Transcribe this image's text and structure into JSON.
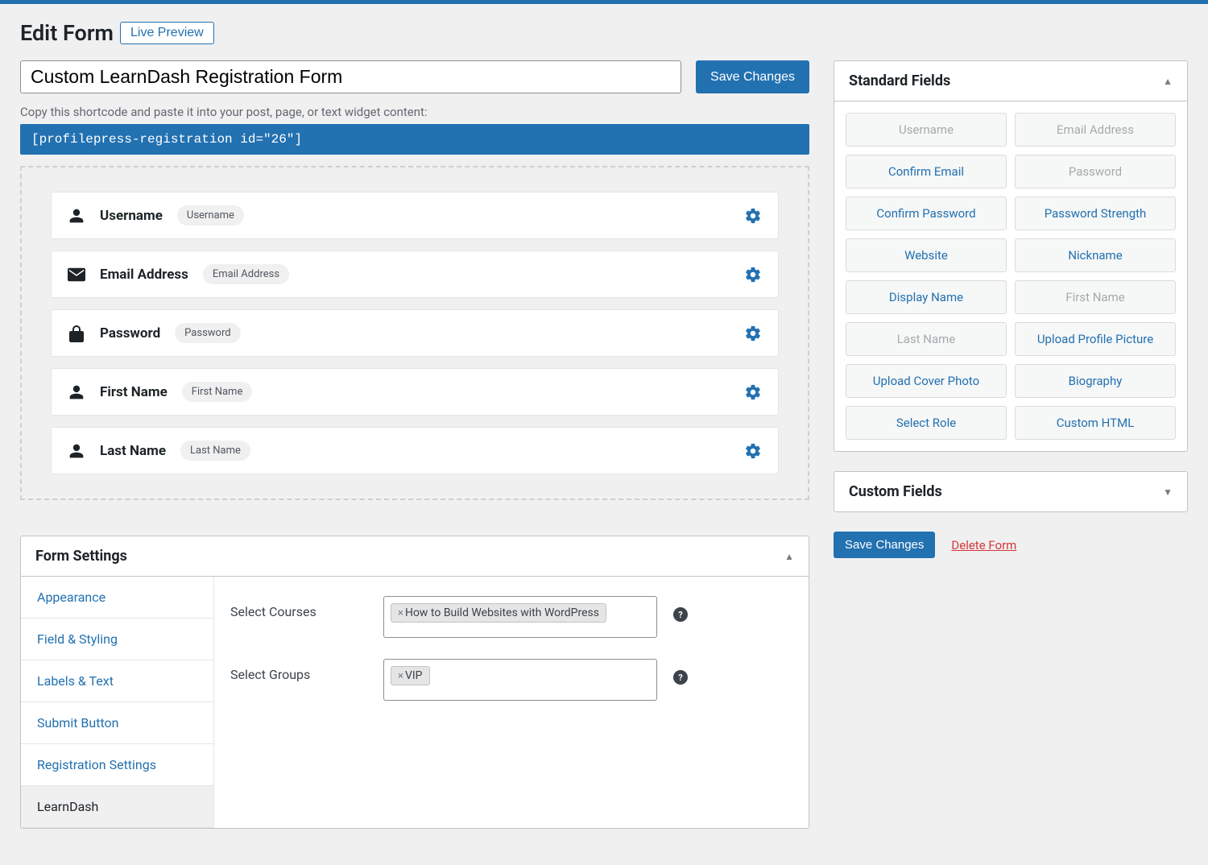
{
  "header": {
    "title": "Edit Form",
    "live_preview_label": "Live Preview"
  },
  "form": {
    "title_value": "Custom LearnDash Registration Form",
    "save_label": "Save Changes",
    "help_text": "Copy this shortcode and paste it into your post, page, or text widget content:",
    "shortcode": "[profilepress-registration id=\"26\"]"
  },
  "fields": [
    {
      "icon": "user",
      "label": "Username",
      "pill": "Username"
    },
    {
      "icon": "mail",
      "label": "Email Address",
      "pill": "Email Address"
    },
    {
      "icon": "lock",
      "label": "Password",
      "pill": "Password"
    },
    {
      "icon": "user",
      "label": "First Name",
      "pill": "First Name"
    },
    {
      "icon": "user",
      "label": "Last Name",
      "pill": "Last Name"
    }
  ],
  "settings": {
    "panel_title": "Form Settings",
    "tabs": [
      {
        "label": "Appearance",
        "active": false
      },
      {
        "label": "Field & Styling",
        "active": false
      },
      {
        "label": "Labels & Text",
        "active": false
      },
      {
        "label": "Submit Button",
        "active": false
      },
      {
        "label": "Registration Settings",
        "active": false
      },
      {
        "label": "LearnDash",
        "active": true
      }
    ],
    "rows": [
      {
        "label": "Select Courses",
        "tags": [
          "How to Build Websites with WordPress"
        ]
      },
      {
        "label": "Select Groups",
        "tags": [
          "VIP"
        ]
      }
    ]
  },
  "standard_fields": {
    "panel_title": "Standard Fields",
    "items": [
      {
        "label": "Username",
        "disabled": true
      },
      {
        "label": "Email Address",
        "disabled": true
      },
      {
        "label": "Confirm Email",
        "disabled": false
      },
      {
        "label": "Password",
        "disabled": true
      },
      {
        "label": "Confirm Password",
        "disabled": false
      },
      {
        "label": "Password Strength",
        "disabled": false
      },
      {
        "label": "Website",
        "disabled": false
      },
      {
        "label": "Nickname",
        "disabled": false
      },
      {
        "label": "Display Name",
        "disabled": false
      },
      {
        "label": "First Name",
        "disabled": true
      },
      {
        "label": "Last Name",
        "disabled": true
      },
      {
        "label": "Upload Profile Picture",
        "disabled": false
      },
      {
        "label": "Upload Cover Photo",
        "disabled": false
      },
      {
        "label": "Biography",
        "disabled": false
      },
      {
        "label": "Select Role",
        "disabled": false
      },
      {
        "label": "Custom HTML",
        "disabled": false
      }
    ]
  },
  "custom_fields": {
    "panel_title": "Custom Fields"
  },
  "side_actions": {
    "save_label": "Save Changes",
    "delete_label": "Delete Form"
  }
}
